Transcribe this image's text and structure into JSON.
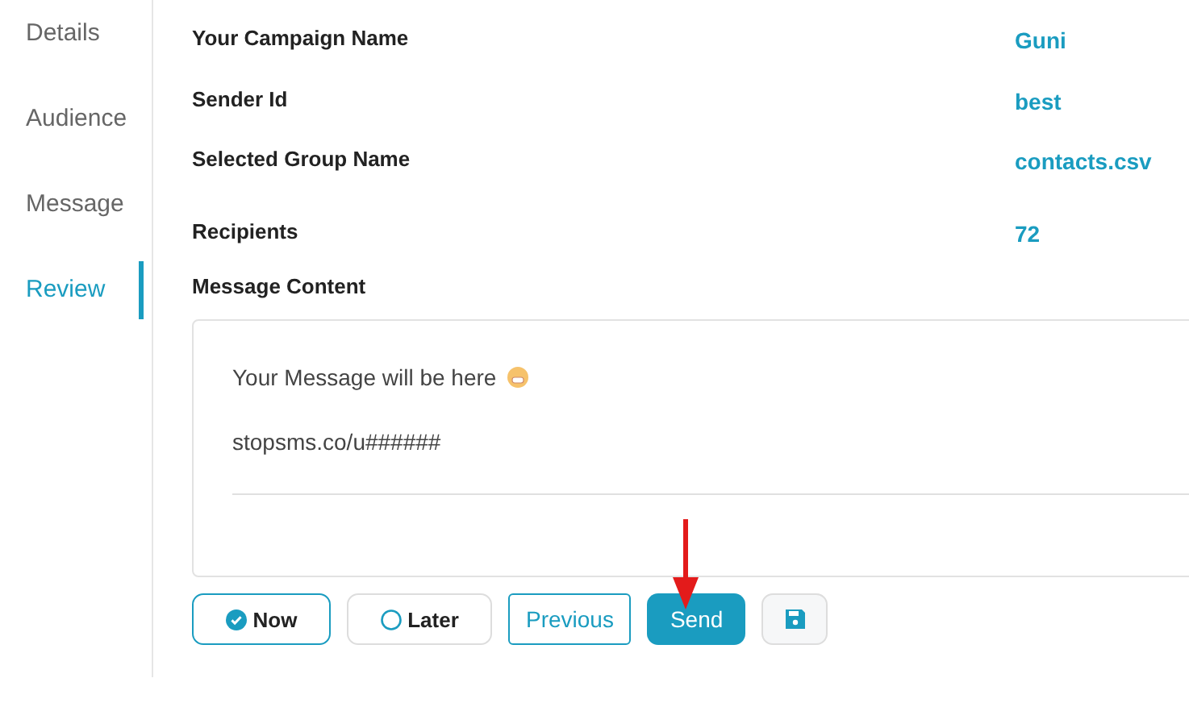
{
  "steps": [
    {
      "label": "Details",
      "selected": false
    },
    {
      "label": "Audience",
      "selected": false
    },
    {
      "label": "Message",
      "selected": false
    },
    {
      "label": "Review",
      "selected": true
    }
  ],
  "summary": [
    {
      "label": "Your Campaign Name",
      "value": "Guni"
    },
    {
      "label": "Sender Id",
      "value": "best"
    },
    {
      "label": "Selected Group Name",
      "value": "contacts.csv"
    },
    {
      "label": "Recipients",
      "value": "72"
    }
  ],
  "message_content": {
    "label": "Message Content",
    "lines": [
      {
        "text": "Your Message will be here",
        "emoji": true
      },
      {
        "text": "stopsms.co/u######",
        "emoji": false
      }
    ]
  },
  "schedule": [
    {
      "label": "Now",
      "selected": true
    },
    {
      "label": "Later",
      "selected": false
    }
  ],
  "buttons": {
    "previous": "Previous",
    "send": "Send"
  }
}
